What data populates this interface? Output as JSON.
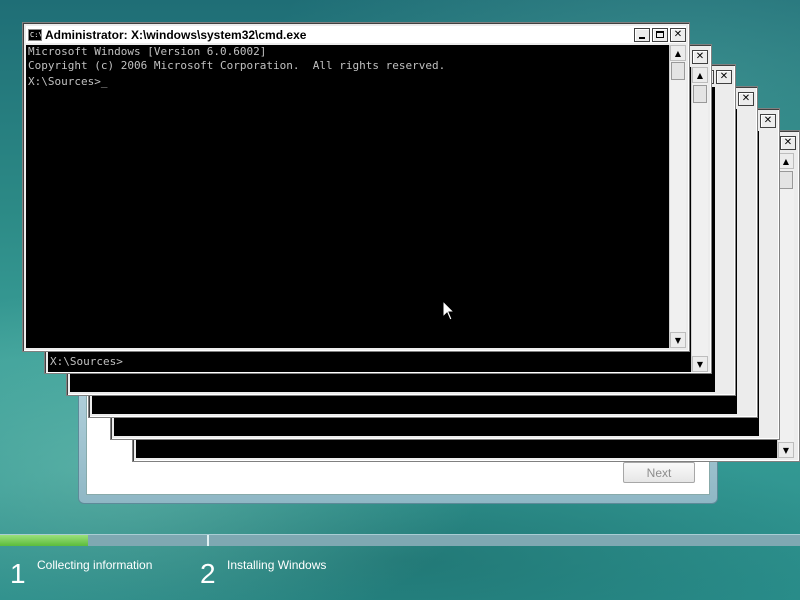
{
  "setup_dialog": {
    "next_label": "Next"
  },
  "windows": [
    {
      "title": "Administrator: X:\\windows\\system32\\cmd.exe",
      "lines": [
        "Microsoft Windows [Version 6.0.6002]",
        "Copyright (c) 2006 Microsoft Corporation.  All rights reserved.",
        "",
        "X:\\Sources>_"
      ]
    },
    {
      "lines": [
        "X:\\Sources>"
      ]
    }
  ],
  "caption_buttons": {
    "close": "✕"
  },
  "taskbar": {
    "progress_fraction": 0.11,
    "steps": [
      {
        "number": "1",
        "label": "Collecting information"
      },
      {
        "number": "2",
        "label": "Installing Windows"
      }
    ]
  },
  "colors": {
    "accent_green": "#5cbc3c",
    "console_bg": "#000000",
    "console_fg": "#c0c0c0"
  }
}
